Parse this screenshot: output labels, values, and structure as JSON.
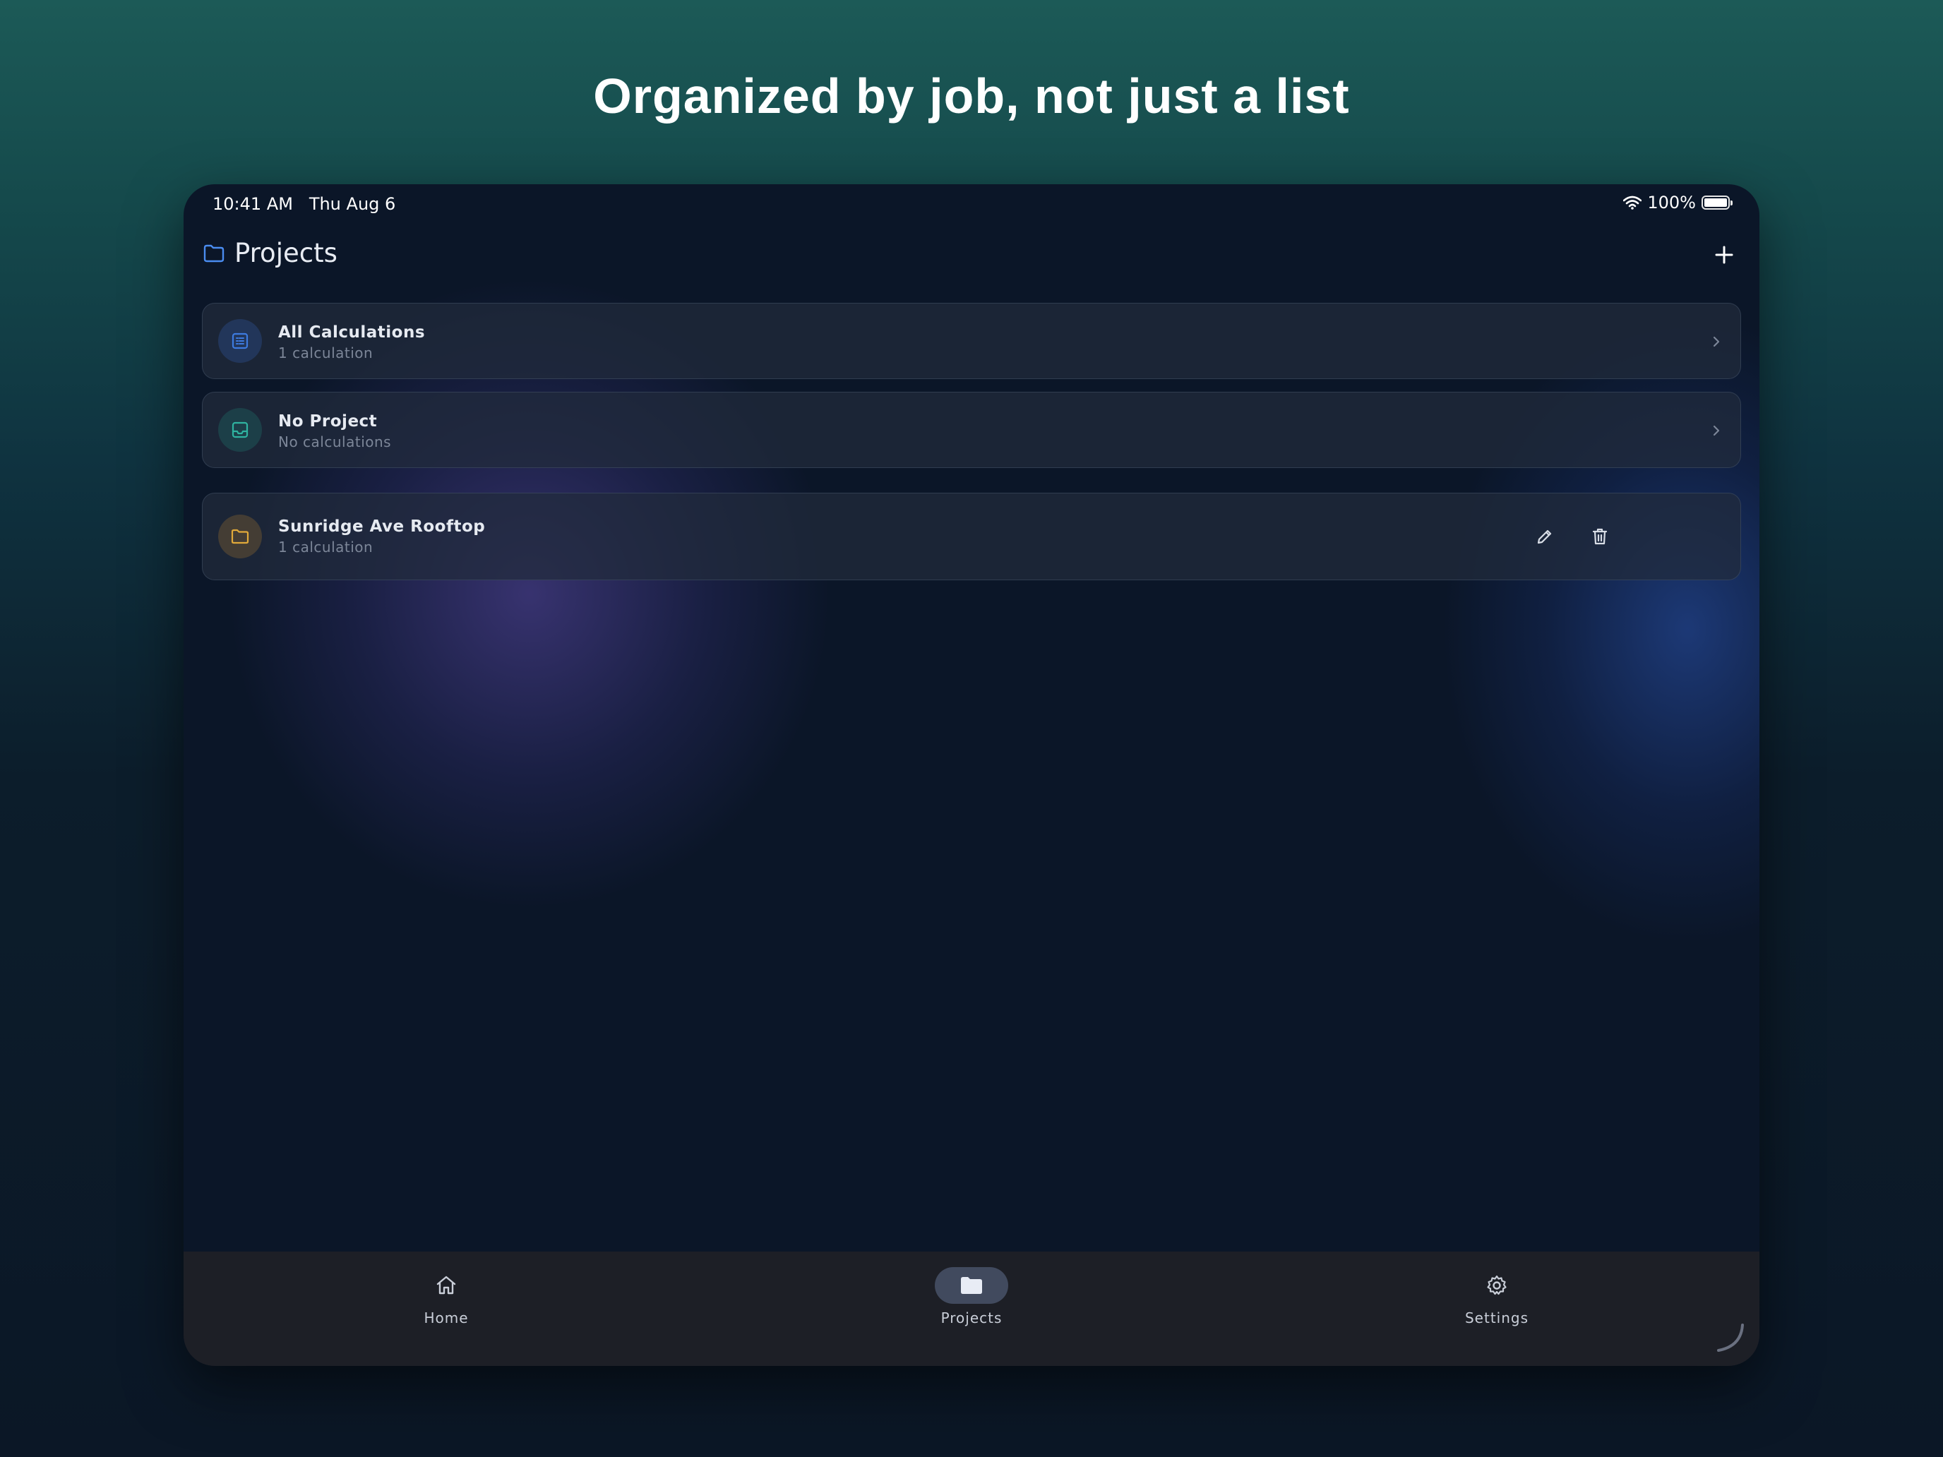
{
  "headline": "Organized by job, not just a list",
  "status": {
    "time": "10:41 AM",
    "date": "Thu Aug 6",
    "battery": "100%",
    "battery_level": 1.0
  },
  "header": {
    "title": "Projects",
    "add_icon": "plus-icon",
    "title_icon": "folder-icon"
  },
  "rows": [
    {
      "title": "All Calculations",
      "subtitle": "1 calculation",
      "icon": "list-icon",
      "icon_color": "#3d7be0"
    },
    {
      "title": "No Project",
      "subtitle": "No calculations",
      "icon": "inbox-icon",
      "icon_color": "#2fb3a0"
    },
    {
      "title": "Sunridge Ave Rooftop",
      "subtitle": "1 calculation",
      "icon": "folder-icon",
      "icon_color": "#e0a93a"
    }
  ],
  "tabs": [
    {
      "label": "Home",
      "icon": "home-icon",
      "selected": false
    },
    {
      "label": "Projects",
      "icon": "folder-icon",
      "selected": true
    },
    {
      "label": "Settings",
      "icon": "gear-icon",
      "selected": false
    }
  ],
  "colors": {
    "accent": "#3d7be0",
    "background": "#0b1628",
    "tab_selected_bg": "#414a5e"
  }
}
